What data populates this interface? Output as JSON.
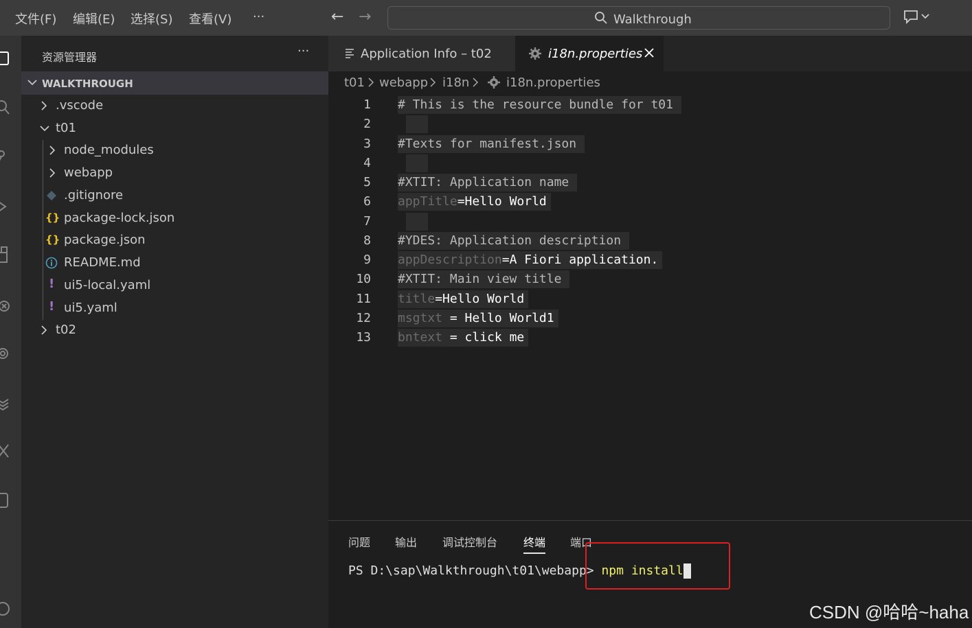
{
  "menu": [
    "文件(F)",
    "编辑(E)",
    "选择(S)",
    "查看(V)",
    "···"
  ],
  "search": {
    "text": "Walkthrough"
  },
  "sidebar": {
    "title": "资源管理器",
    "more": "···",
    "section": "WALKTHROUGH",
    "items": [
      {
        "label": ".vscode",
        "type": "folder",
        "expanded": false
      },
      {
        "label": "t01",
        "type": "folder",
        "expanded": true
      },
      {
        "label": "node_modules",
        "type": "folder",
        "expanded": false
      },
      {
        "label": "webapp",
        "type": "folder",
        "expanded": false
      },
      {
        "label": ".gitignore",
        "type": "file",
        "icon": "git-icon"
      },
      {
        "label": "package-lock.json",
        "type": "file",
        "icon": "json-braces-icon"
      },
      {
        "label": "package.json",
        "type": "file",
        "icon": "json-braces-icon"
      },
      {
        "label": "README.md",
        "type": "file",
        "icon": "info-icon"
      },
      {
        "label": "ui5-local.yaml",
        "type": "file",
        "icon": "yaml-exclamation-icon"
      },
      {
        "label": "ui5.yaml",
        "type": "file",
        "icon": "yaml-exclamation-icon"
      },
      {
        "label": "t02",
        "type": "folder",
        "expanded": false
      }
    ]
  },
  "tabs": [
    {
      "label": "Application Info – t02",
      "active": false
    },
    {
      "label": "i18n.properties",
      "active": true
    }
  ],
  "breadcrumb": [
    "t01",
    "webapp",
    "i18n",
    "i18n.properties"
  ],
  "editor": {
    "lines": [
      {
        "n": "1",
        "text": "# This is the resource bundle for t01"
      },
      {
        "n": "2",
        "text": ""
      },
      {
        "n": "3",
        "text": "#Texts for manifest.json"
      },
      {
        "n": "4",
        "text": ""
      },
      {
        "n": "5",
        "text": "#XTIT: Application name"
      },
      {
        "n": "6",
        "key": "appTitle",
        "sep": "=",
        "value": "Hello World"
      },
      {
        "n": "7",
        "text": ""
      },
      {
        "n": "8",
        "text": "#YDES: Application description"
      },
      {
        "n": "9",
        "key": "appDescription",
        "sep": "=",
        "value": "A Fiori application."
      },
      {
        "n": "10",
        "text": "#XTIT: Main view title"
      },
      {
        "n": "11",
        "key": "title",
        "sep": "=",
        "value": "Hello World"
      },
      {
        "n": "12",
        "key": "msgtxt",
        "sep": " = ",
        "value": "Hello World1"
      },
      {
        "n": "13",
        "key": "bntext",
        "sep": " = ",
        "value": "click me"
      }
    ]
  },
  "panel": {
    "tabs": [
      "问题",
      "输出",
      "调试控制台",
      "终端",
      "端口"
    ],
    "active_tab": "终端",
    "prompt": "PS D:\\sap\\Walkthrough\\t01\\webapp> ",
    "command": "npm install"
  },
  "watermark": "CSDN @哈哈~haha",
  "colors": {
    "highlight": "#e02020",
    "json_icon": "#e8c02a",
    "yaml_icon": "#a074c4",
    "info_icon": "#519aba"
  }
}
